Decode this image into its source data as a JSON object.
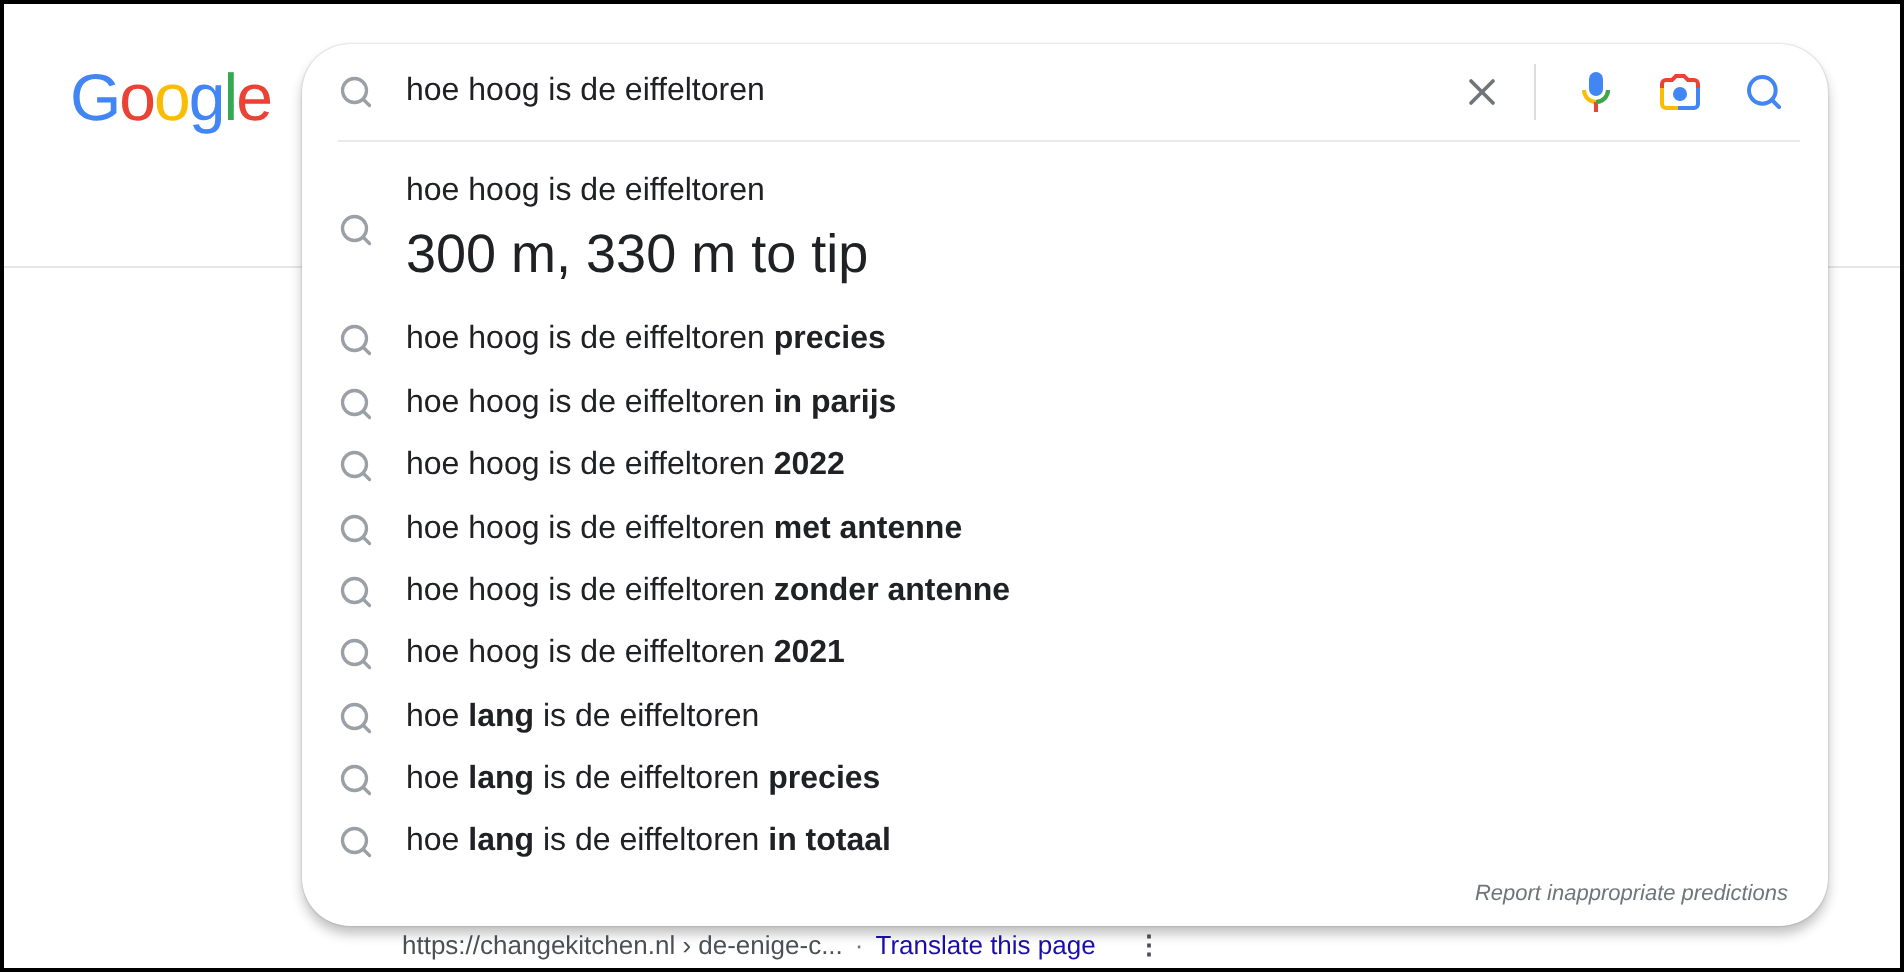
{
  "logo": "Google",
  "search": {
    "value": "hoe hoog is de eiffeltoren"
  },
  "answer": {
    "query": "hoe hoog is de eiffeltoren",
    "text": "300 m, 330 m to tip"
  },
  "suggestions": [
    {
      "text": "hoe hoog is de eiffeltoren **precies**"
    },
    {
      "text": "hoe hoog is de eiffeltoren **in parijs**"
    },
    {
      "text": "hoe hoog is de eiffeltoren **2022**"
    },
    {
      "text": "hoe hoog is de eiffeltoren **met antenne**"
    },
    {
      "text": "hoe hoog is de eiffeltoren **zonder antenne**"
    },
    {
      "text": "hoe hoog is de eiffeltoren **2021**"
    },
    {
      "text": "hoe **lang** is de eiffeltoren"
    },
    {
      "text": "hoe **lang** is de eiffeltoren **precies**"
    },
    {
      "text": "hoe **lang** is de eiffeltoren **in totaal**"
    }
  ],
  "report_link": "Report inappropriate predictions",
  "result": {
    "url": "https://changekitchen.nl › de-enige-c...",
    "separator": "·",
    "translate": "Translate this page",
    "menu": "⋮"
  }
}
